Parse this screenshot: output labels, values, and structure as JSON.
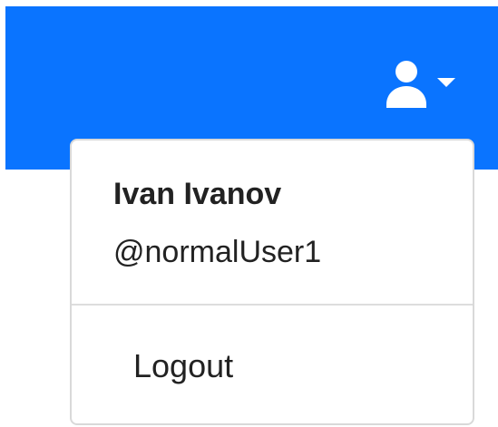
{
  "theme": {
    "brand": "#0a74ff"
  },
  "header": {
    "user_menu_icon": "user-icon",
    "dropdown_indicator_icon": "caret-down-icon"
  },
  "dropdown": {
    "user_name": "Ivan Ivanov",
    "user_handle": "@normalUser1",
    "logout_label": "Logout"
  }
}
